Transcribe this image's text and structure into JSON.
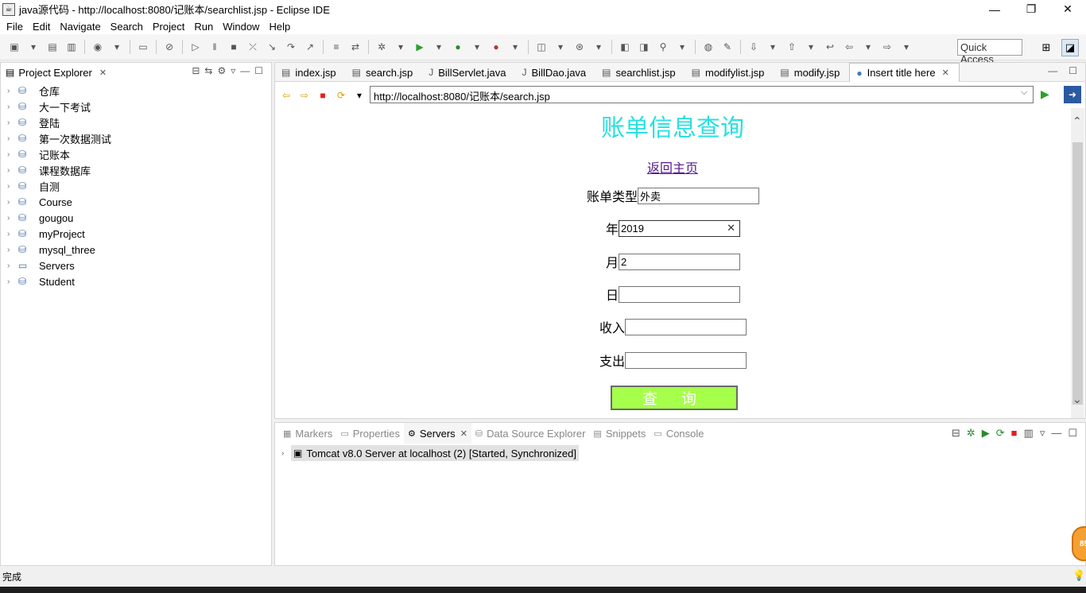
{
  "window": {
    "title": "java源代码 - http://localhost:8080/记账本/searchlist.jsp - Eclipse IDE",
    "minimize": "—",
    "restore": "❐",
    "close": "✕"
  },
  "menu": [
    "File",
    "Edit",
    "Navigate",
    "Search",
    "Project",
    "Run",
    "Window",
    "Help"
  ],
  "toolbar": {
    "quick_access": "Quick Access"
  },
  "project_explorer": {
    "title": "Project Explorer",
    "items": [
      "仓库",
      "大一下考试",
      "登陆",
      "第一次数据测试",
      "记账本",
      "课程数据库",
      "自测",
      "Course",
      "gougou",
      "myProject",
      "mysql_three",
      "Servers",
      "Student"
    ]
  },
  "editor_tabs": [
    {
      "label": "index.jsp",
      "icon": "jsp-file-icon"
    },
    {
      "label": "search.jsp",
      "icon": "jsp-file-icon"
    },
    {
      "label": "BillServlet.java",
      "icon": "java-file-icon"
    },
    {
      "label": "BillDao.java",
      "icon": "java-file-icon"
    },
    {
      "label": "searchlist.jsp",
      "icon": "jsp-file-icon"
    },
    {
      "label": "modifylist.jsp",
      "icon": "jsp-file-icon"
    },
    {
      "label": "modify.jsp",
      "icon": "jsp-file-icon"
    },
    {
      "label": "Insert title here",
      "icon": "globe-icon",
      "active": true
    }
  ],
  "browser": {
    "url": "http://localhost:8080/记账本/search.jsp"
  },
  "page": {
    "title": "账单信息查询",
    "back_link": "返回主页",
    "fields": {
      "type_label": "账单类型",
      "type_value": "外卖",
      "year_label": "年",
      "year_value": "2019",
      "month_label": "月",
      "month_value": "2",
      "day_label": "日",
      "day_value": "",
      "income_label": "收入",
      "income_value": "",
      "expense_label": "支出",
      "expense_value": ""
    },
    "submit": "查 询"
  },
  "bottom_tabs": [
    {
      "label": "Markers",
      "active": false
    },
    {
      "label": "Properties",
      "active": false
    },
    {
      "label": "Servers",
      "active": true
    },
    {
      "label": "Data Source Explorer",
      "active": false
    },
    {
      "label": "Snippets",
      "active": false
    },
    {
      "label": "Console",
      "active": false
    }
  ],
  "servers": {
    "entry": "Tomcat v8.0 Server at localhost (2)  [Started, Synchronized]"
  },
  "status": {
    "text": "完成",
    "badge": "85"
  },
  "colors": {
    "page_title": "#28e0e0",
    "submit_bg": "#a6ff4a",
    "link": "#551a8b"
  }
}
